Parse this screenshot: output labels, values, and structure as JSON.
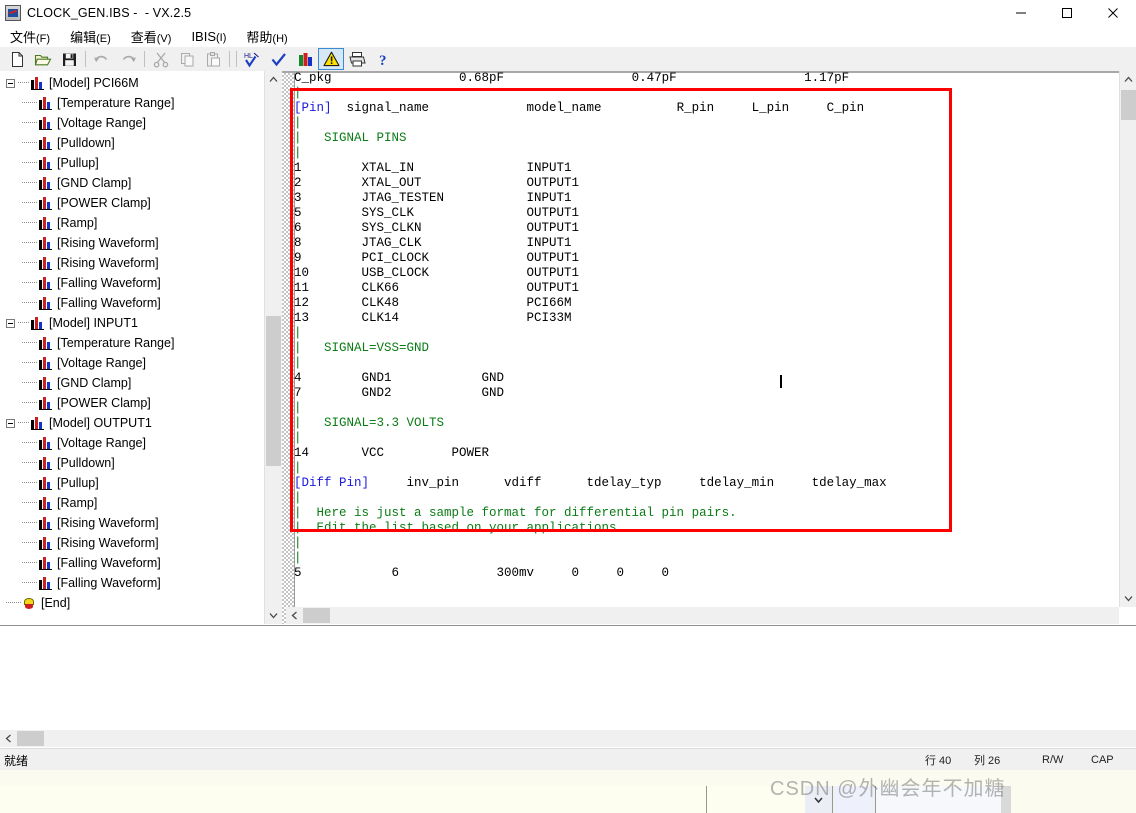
{
  "window": {
    "title": "CLOCK_GEN.IBS -  - VX.2.5",
    "icon": "app-icon",
    "minimize": "–",
    "maximize": "□",
    "close": "✕"
  },
  "menubar": {
    "items": [
      {
        "label": "文件",
        "mnemonic": "(F)"
      },
      {
        "label": "编辑",
        "mnemonic": "(E)"
      },
      {
        "label": "查看",
        "mnemonic": "(V)"
      },
      {
        "label": "IBIS",
        "mnemonic": "(I)"
      },
      {
        "label": "帮助",
        "mnemonic": "(H)"
      }
    ]
  },
  "toolbar": {
    "buttons": [
      {
        "name": "new-file-icon",
        "tip": "New"
      },
      {
        "name": "open-folder-icon",
        "tip": "Open"
      },
      {
        "name": "save-disk-icon",
        "tip": "Save"
      },
      {
        "name": "undo-arrow-icon",
        "tip": "Undo"
      },
      {
        "name": "redo-arrow-icon",
        "tip": "Redo"
      },
      {
        "name": "cut-scissors-icon",
        "tip": "Cut"
      },
      {
        "name": "copy-icon",
        "tip": "Copy"
      },
      {
        "name": "paste-icon",
        "tip": "Paste"
      },
      {
        "name": "highlight-check-icon",
        "tip": "HL Check"
      },
      {
        "name": "check-icon",
        "tip": "Check"
      },
      {
        "name": "model-bars-icon",
        "tip": "Model"
      },
      {
        "name": "warning-icon",
        "tip": "Warnings",
        "selected": true
      },
      {
        "name": "print-icon",
        "tip": "Print"
      },
      {
        "name": "help-icon",
        "tip": "Help"
      }
    ]
  },
  "tree": {
    "nodes": [
      {
        "label": "[Model] PCI66M",
        "level": 0,
        "icon": "model-icon",
        "expander": "minus"
      },
      {
        "label": "[Temperature Range]",
        "level": 1,
        "icon": "model-icon"
      },
      {
        "label": "[Voltage Range]",
        "level": 1,
        "icon": "model-icon"
      },
      {
        "label": "[Pulldown]",
        "level": 1,
        "icon": "model-icon"
      },
      {
        "label": "[Pullup]",
        "level": 1,
        "icon": "model-icon"
      },
      {
        "label": "[GND Clamp]",
        "level": 1,
        "icon": "model-icon"
      },
      {
        "label": "[POWER Clamp]",
        "level": 1,
        "icon": "model-icon"
      },
      {
        "label": "[Ramp]",
        "level": 1,
        "icon": "model-icon"
      },
      {
        "label": "[Rising Waveform]",
        "level": 1,
        "icon": "model-icon"
      },
      {
        "label": "[Rising Waveform]",
        "level": 1,
        "icon": "model-icon"
      },
      {
        "label": "[Falling Waveform]",
        "level": 1,
        "icon": "model-icon"
      },
      {
        "label": "[Falling Waveform]",
        "level": 1,
        "icon": "model-icon"
      },
      {
        "label": "[Model] INPUT1",
        "level": 0,
        "icon": "model-icon",
        "expander": "minus"
      },
      {
        "label": "[Temperature Range]",
        "level": 1,
        "icon": "model-icon"
      },
      {
        "label": "[Voltage Range]",
        "level": 1,
        "icon": "model-icon"
      },
      {
        "label": "[GND Clamp]",
        "level": 1,
        "icon": "model-icon"
      },
      {
        "label": "[POWER Clamp]",
        "level": 1,
        "icon": "model-icon"
      },
      {
        "label": "[Model] OUTPUT1",
        "level": 0,
        "icon": "model-icon",
        "expander": "minus"
      },
      {
        "label": "[Voltage Range]",
        "level": 1,
        "icon": "model-icon"
      },
      {
        "label": "[Pulldown]",
        "level": 1,
        "icon": "model-icon"
      },
      {
        "label": "[Pullup]",
        "level": 1,
        "icon": "model-icon"
      },
      {
        "label": "[Ramp]",
        "level": 1,
        "icon": "model-icon"
      },
      {
        "label": "[Rising Waveform]",
        "level": 1,
        "icon": "model-icon"
      },
      {
        "label": "[Rising Waveform]",
        "level": 1,
        "icon": "model-icon"
      },
      {
        "label": "[Falling Waveform]",
        "level": 1,
        "icon": "model-icon"
      },
      {
        "label": "[Falling Waveform]",
        "level": 1,
        "icon": "model-icon"
      },
      {
        "label": "[End]",
        "level": 0,
        "icon": "end-icon"
      }
    ]
  },
  "editor": {
    "lines": [
      [
        {
          "t": "C_pkg",
          "c": "p"
        },
        {
          "t": "                 0.68pF                 0.47pF                 1.17pF",
          "c": "p"
        }
      ],
      [
        {
          "t": "|",
          "c": "pipe"
        }
      ],
      [
        {
          "t": "[Pin]",
          "c": "kw"
        },
        {
          "t": "  signal_name             model_name          R_pin     L_pin     C_pin",
          "c": "p"
        }
      ],
      [
        {
          "t": "|",
          "c": "pipe"
        }
      ],
      [
        {
          "t": "|   SIGNAL PINS",
          "c": "cmt"
        }
      ],
      [
        {
          "t": "|",
          "c": "pipe"
        }
      ],
      [
        {
          "t": "1        XTAL_IN               INPUT1",
          "c": "p"
        }
      ],
      [
        {
          "t": "2        XTAL_OUT              OUTPUT1",
          "c": "p"
        }
      ],
      [
        {
          "t": "3        JTAG_TESTEN           INPUT1",
          "c": "p"
        }
      ],
      [
        {
          "t": "5        SYS_CLK               OUTPUT1",
          "c": "p"
        }
      ],
      [
        {
          "t": "6        SYS_CLKN              OUTPUT1",
          "c": "p"
        }
      ],
      [
        {
          "t": "8        JTAG_CLK              INPUT1",
          "c": "p"
        }
      ],
      [
        {
          "t": "9        PCI_CLOCK             OUTPUT1",
          "c": "p"
        }
      ],
      [
        {
          "t": "10       USB_CLOCK             OUTPUT1",
          "c": "p"
        }
      ],
      [
        {
          "t": "11       CLK66                 OUTPUT1",
          "c": "p"
        }
      ],
      [
        {
          "t": "12       CLK48                 PCI66M",
          "c": "p"
        }
      ],
      [
        {
          "t": "13       CLK14                 PCI33M",
          "c": "p"
        }
      ],
      [
        {
          "t": "|",
          "c": "pipe"
        }
      ],
      [
        {
          "t": "|   SIGNAL=VSS=GND",
          "c": "cmt"
        }
      ],
      [
        {
          "t": "|",
          "c": "pipe"
        }
      ],
      [
        {
          "t": "4        GND1            GND",
          "c": "p"
        }
      ],
      [
        {
          "t": "7        GND2            GND",
          "c": "p"
        }
      ],
      [
        {
          "t": "|",
          "c": "pipe"
        }
      ],
      [
        {
          "t": "|   SIGNAL=3.3 VOLTS",
          "c": "cmt"
        }
      ],
      [
        {
          "t": "|",
          "c": "pipe"
        }
      ],
      [
        {
          "t": "14       VCC         POWER",
          "c": "p"
        }
      ],
      [
        {
          "t": "|",
          "c": "pipe"
        }
      ],
      [
        {
          "t": "[Diff Pin]",
          "c": "kw"
        },
        {
          "t": "     inv_pin      vdiff      tdelay_typ     tdelay_min     tdelay_max",
          "c": "p"
        }
      ],
      [
        {
          "t": "|",
          "c": "pipe"
        }
      ],
      [
        {
          "t": "|  Here is just a sample format for differential pin pairs.",
          "c": "cmt"
        }
      ],
      [
        {
          "t": "|  Edit the list based on your applications.",
          "c": "cmt"
        }
      ],
      [
        {
          "t": "|",
          "c": "pipe"
        }
      ],
      [
        {
          "t": "|",
          "c": "pipe"
        }
      ],
      [
        {
          "t": "5            6             300mv     0     0     0",
          "c": "p"
        }
      ]
    ],
    "highlight_box_color": "#ff0000",
    "caret_visible": true
  },
  "statusbar": {
    "ready": "就绪",
    "line": "行 40",
    "column": "列 26",
    "rw": "R/W",
    "cap": "CAP"
  },
  "watermark": {
    "text": "CSDN @外幽会年不加糖"
  }
}
